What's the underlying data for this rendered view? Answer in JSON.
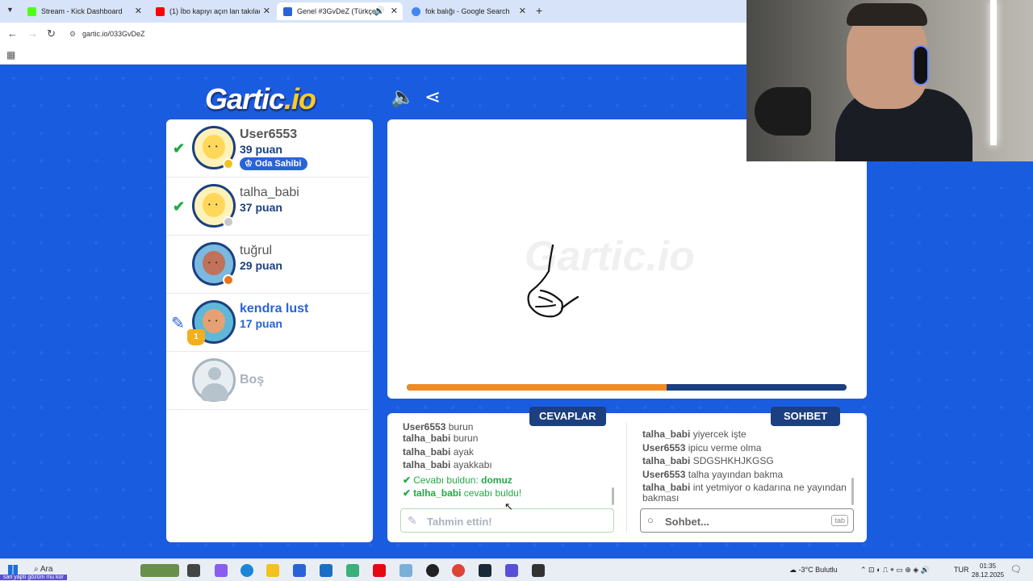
{
  "browser": {
    "tabs": [
      {
        "label": "Stream - Kick Dashboard",
        "color": "#53fc18"
      },
      {
        "label": "(1) İbo kapıyı açın lan takılacaz",
        "color": "#ff0000"
      },
      {
        "label": "Genel #3GvDeZ (Türkçe) -",
        "color": "#2a63d8"
      },
      {
        "label": "fok balığı - Google Search",
        "color": "#4285f4"
      }
    ],
    "url": "gartic.io/033GvDeZ"
  },
  "game": {
    "logo_main": "Gartic",
    "logo_suffix": ".io",
    "players": [
      {
        "name": "User6553",
        "score": "39 puan",
        "badge": "Oda Sahibi",
        "status_color": "#f2c21e",
        "skin": "#ffd85a",
        "bg": "#fff2b8"
      },
      {
        "name": "talha_babi",
        "score": "37 puan",
        "status_color": "#c8c8c8",
        "skin": "#ffd85a",
        "bg": "#fff2b8"
      },
      {
        "name": "tuğrul",
        "score": "29 puan",
        "status_color": "#e8741a",
        "skin": "#c0725a",
        "bg": "#7ab9e0"
      },
      {
        "name": "kendra lust",
        "score": "17 puan",
        "trophy": "1",
        "status_color": "#2a63d8",
        "skin": "#e5a173",
        "bg": "#5fb8d8"
      }
    ],
    "empty_slot": "Boş",
    "timer_progress": 0.59,
    "answers_title": "CEVAPLAR",
    "chat_title": "SOHBET",
    "answers": [
      {
        "who": "User6553",
        "text": "burun"
      },
      {
        "who": "talha_babi",
        "text": "burun"
      },
      {
        "who": "talha_babi",
        "text": "ayak"
      },
      {
        "who": "talha_babi",
        "text": "ayakkabı"
      }
    ],
    "found_prefix": "Cevabı buldun:",
    "found_answer": "domuz",
    "found_other_who": "talha_babi",
    "found_other_text": "cevabı buldu!",
    "chat": [
      {
        "who": "talha_babi",
        "text": "yiyercek işte"
      },
      {
        "who": "User6553",
        "text": "ipicu verme olma"
      },
      {
        "who": "talha_babi",
        "text": "SDGSHKHJKGSG"
      },
      {
        "who": "User6553",
        "text": "talha yayından bakma"
      },
      {
        "who": "talha_babi",
        "text": "int yetmiyor o kadarına ne yayından bakması"
      }
    ],
    "guess_placeholder": "Tahmin ettin!",
    "chat_placeholder": "Sohbet...",
    "chat_tab_hint": "tab"
  },
  "taskbar": {
    "search_label": "Ara",
    "notification": "sari yaptı gözüm mu kor",
    "weather": "-3°C  Bulutlu",
    "lang": "TUR",
    "time": "01:35",
    "date": "28.12.2025"
  }
}
